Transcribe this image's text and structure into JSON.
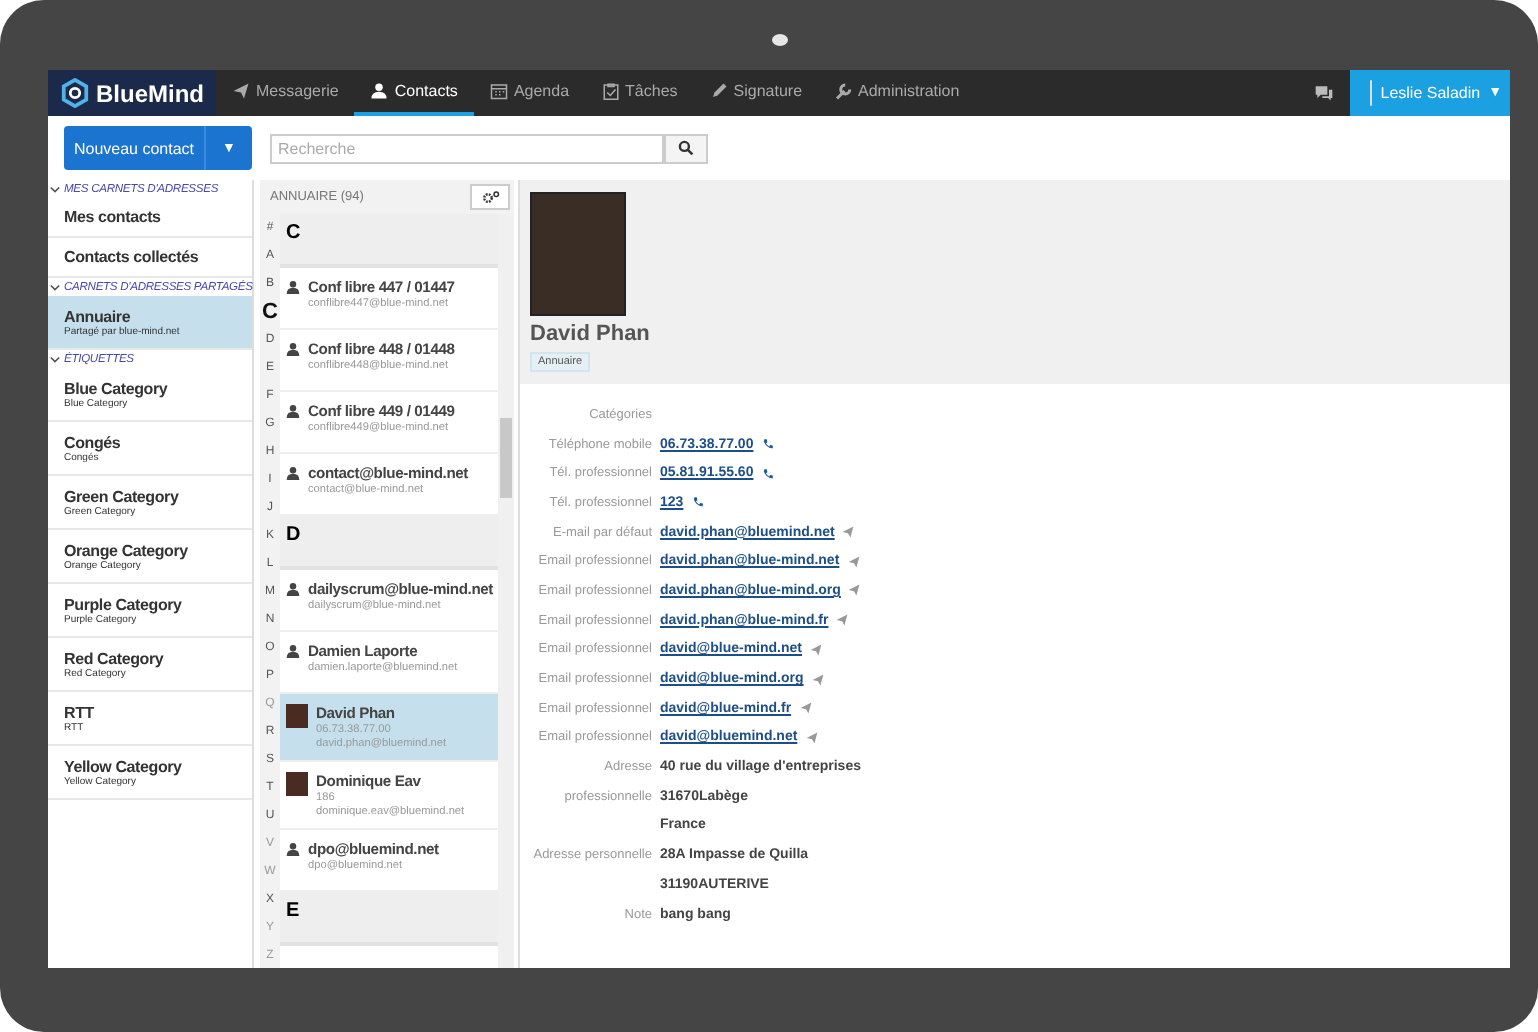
{
  "brand": {
    "name": "BlueMind"
  },
  "nav": [
    {
      "label": "Messagerie",
      "selected": false
    },
    {
      "label": "Contacts",
      "selected": true
    },
    {
      "label": "Agenda",
      "selected": false
    },
    {
      "label": "Tâches",
      "selected": false
    },
    {
      "label": "Signature",
      "selected": false
    },
    {
      "label": "Administration",
      "selected": false
    }
  ],
  "user": {
    "name": "Leslie Saladin",
    "caret": "▼"
  },
  "toolbar": {
    "new_button": "Nouveau contact",
    "split_caret": "▼",
    "search": {
      "placeholder": "Recherche"
    }
  },
  "sidebar": {
    "sections": [
      {
        "title": "MES CARNETS D'ADRESSES",
        "items": [
          {
            "label": "Mes contacts",
            "selected": false
          },
          {
            "label": "Contacts collectés",
            "selected": false
          }
        ]
      },
      {
        "title": "CARNETS D'ADRESSES PARTAGÉS",
        "items": [
          {
            "label": "Annuaire",
            "sub": "Partagé par blue-mind.net",
            "selected": true
          }
        ]
      },
      {
        "title": "ÉTIQUETTES",
        "items": [
          {
            "label": "Blue Category",
            "sub": "Blue Category",
            "selected": false
          },
          {
            "label": "Congés",
            "sub": "Congés",
            "selected": false
          },
          {
            "label": "Green Category",
            "sub": "Green Category",
            "selected": false
          },
          {
            "label": "Orange Category",
            "sub": "Orange Category",
            "selected": false
          },
          {
            "label": "Purple Category",
            "sub": "Purple Category",
            "selected": false
          },
          {
            "label": "Red Category",
            "sub": "Red Category",
            "selected": false
          },
          {
            "label": "RTT",
            "sub": "RTT",
            "selected": false
          },
          {
            "label": "Yellow Category",
            "sub": "Yellow Category",
            "selected": false
          }
        ]
      }
    ]
  },
  "list": {
    "title": "ANNUAIRE (94)",
    "index": [
      {
        "letter": "#",
        "selected": false,
        "disabled": false
      },
      {
        "letter": "A",
        "selected": false,
        "disabled": false
      },
      {
        "letter": "B",
        "selected": false,
        "disabled": false
      },
      {
        "letter": "C",
        "selected": true,
        "disabled": false
      },
      {
        "letter": "D",
        "selected": false,
        "disabled": false
      },
      {
        "letter": "E",
        "selected": false,
        "disabled": false
      },
      {
        "letter": "F",
        "selected": false,
        "disabled": false
      },
      {
        "letter": "G",
        "selected": false,
        "disabled": false
      },
      {
        "letter": "H",
        "selected": false,
        "disabled": false
      },
      {
        "letter": "I",
        "selected": false,
        "disabled": false
      },
      {
        "letter": "J",
        "selected": false,
        "disabled": false
      },
      {
        "letter": "K",
        "selected": false,
        "disabled": false
      },
      {
        "letter": "L",
        "selected": false,
        "disabled": false
      },
      {
        "letter": "M",
        "selected": false,
        "disabled": false
      },
      {
        "letter": "N",
        "selected": false,
        "disabled": false
      },
      {
        "letter": "O",
        "selected": false,
        "disabled": false
      },
      {
        "letter": "P",
        "selected": false,
        "disabled": false
      },
      {
        "letter": "Q",
        "selected": false,
        "disabled": true
      },
      {
        "letter": "R",
        "selected": false,
        "disabled": false
      },
      {
        "letter": "S",
        "selected": false,
        "disabled": false
      },
      {
        "letter": "T",
        "selected": false,
        "disabled": false
      },
      {
        "letter": "U",
        "selected": false,
        "disabled": false
      },
      {
        "letter": "V",
        "selected": false,
        "disabled": true
      },
      {
        "letter": "W",
        "selected": false,
        "disabled": true
      },
      {
        "letter": "X",
        "selected": false,
        "disabled": false
      },
      {
        "letter": "Y",
        "selected": false,
        "disabled": true
      },
      {
        "letter": "Z",
        "selected": false,
        "disabled": true
      }
    ],
    "entries": [
      {
        "kind": "header",
        "letter": "C"
      },
      {
        "kind": "contact",
        "name": "Conf libre 447 / 01447",
        "lines": [
          "conflibre447@blue-mind.net"
        ],
        "photo": false,
        "selected": false
      },
      {
        "kind": "contact",
        "name": "Conf libre 448 / 01448",
        "lines": [
          "conflibre448@blue-mind.net"
        ],
        "photo": false,
        "selected": false
      },
      {
        "kind": "contact",
        "name": "Conf libre 449 / 01449",
        "lines": [
          "conflibre449@blue-mind.net"
        ],
        "photo": false,
        "selected": false
      },
      {
        "kind": "contact",
        "name": "contact@blue-mind.net",
        "lines": [
          "contact@blue-mind.net"
        ],
        "photo": false,
        "selected": false
      },
      {
        "kind": "header",
        "letter": "D"
      },
      {
        "kind": "contact",
        "name": "dailyscrum@blue-mind.net",
        "lines": [
          "dailyscrum@blue-mind.net"
        ],
        "photo": false,
        "selected": false
      },
      {
        "kind": "contact",
        "name": "Damien Laporte",
        "lines": [
          "damien.laporte@bluemind.net"
        ],
        "photo": false,
        "selected": false
      },
      {
        "kind": "contact",
        "name": "David Phan",
        "lines": [
          "06.73.38.77.00",
          "david.phan@bluemind.net"
        ],
        "photo": true,
        "selected": true
      },
      {
        "kind": "contact",
        "name": "Dominique Eav",
        "lines": [
          "186",
          "dominique.eav@bluemind.net"
        ],
        "photo": true,
        "selected": false
      },
      {
        "kind": "contact",
        "name": "dpo@bluemind.net",
        "lines": [
          "dpo@bluemind.net"
        ],
        "photo": false,
        "selected": false
      },
      {
        "kind": "header",
        "letter": "E"
      }
    ]
  },
  "detail": {
    "name": "David Phan",
    "tag": "Annuaire",
    "fields": [
      {
        "kind": "empty",
        "label": "Catégories"
      },
      {
        "kind": "phone",
        "label": "Téléphone mobile",
        "value": "06.73.38.77.00"
      },
      {
        "kind": "phone",
        "label": "Tél. professionnel",
        "value": "05.81.91.55.60"
      },
      {
        "kind": "phone",
        "label": "Tél. professionnel",
        "value": "123"
      },
      {
        "kind": "email",
        "label": "E-mail par défaut",
        "value": "david.phan@bluemind.net"
      },
      {
        "kind": "email",
        "label": "Email professionnel",
        "value": "david.phan@blue-mind.net"
      },
      {
        "kind": "email",
        "label": "Email professionnel",
        "value": "david.phan@blue-mind.org"
      },
      {
        "kind": "email",
        "label": "Email professionnel",
        "value": "david.phan@blue-mind.fr"
      },
      {
        "kind": "email",
        "label": "Email professionnel",
        "value": "david@blue-mind.net"
      },
      {
        "kind": "email",
        "label": "Email professionnel",
        "value": "david@blue-mind.org"
      },
      {
        "kind": "email",
        "label": "Email professionnel",
        "value": "david@blue-mind.fr"
      },
      {
        "kind": "email",
        "label": "Email professionnel",
        "value": "david@bluemind.net"
      },
      {
        "kind": "text",
        "label": "Adresse",
        "value": "40 rue du village d'entreprises"
      },
      {
        "kind": "text",
        "label": "professionnelle",
        "value": "31670Labège"
      },
      {
        "kind": "text",
        "value": "France"
      },
      {
        "kind": "text",
        "label": "Adresse personnelle",
        "value": "28A Impasse de Quilla"
      },
      {
        "kind": "text",
        "value": "31190AUTERIVE"
      },
      {
        "kind": "text",
        "label": "Note",
        "value": "bang bang"
      }
    ]
  }
}
